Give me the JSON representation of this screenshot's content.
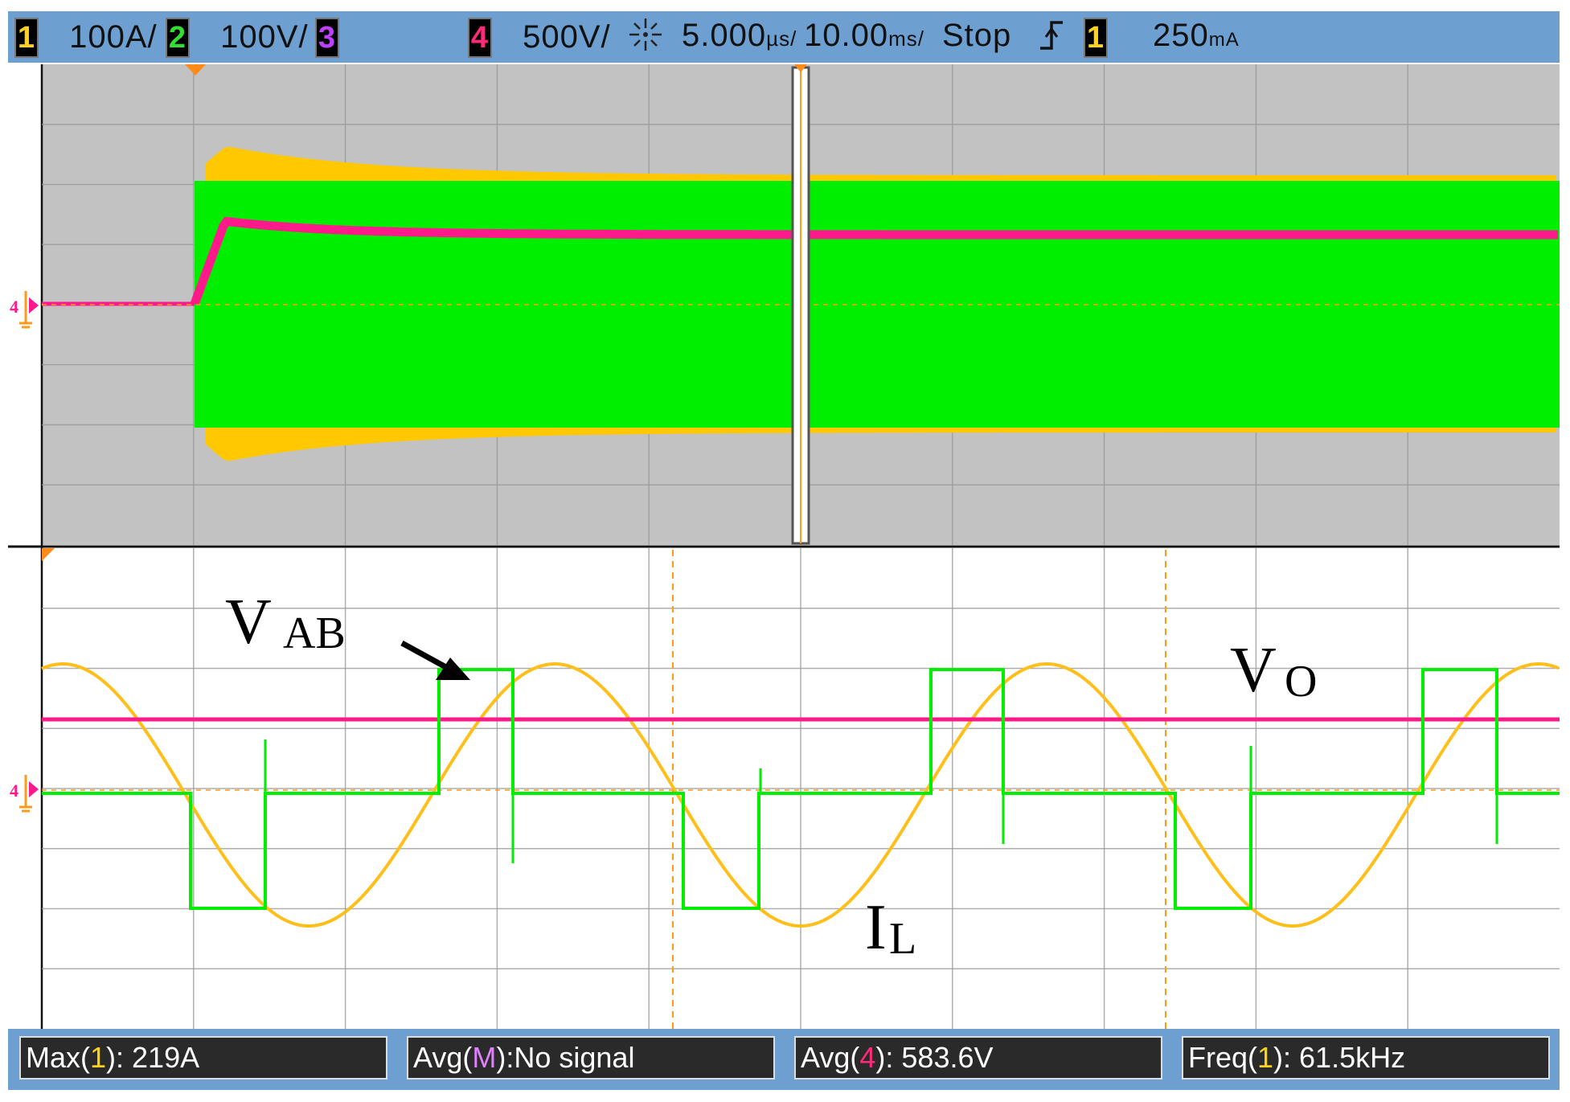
{
  "header": {
    "channels": [
      {
        "num": "1",
        "scale": "100A/",
        "color": "#ffd21a"
      },
      {
        "num": "2",
        "scale": "100V/",
        "color": "#33dd33"
      },
      {
        "num": "3",
        "scale": "",
        "color": "#c040ff"
      },
      {
        "num": "4",
        "scale": "500V/",
        "color": "#ff2a7a"
      }
    ],
    "timebase_zoom": "5.000",
    "timebase_zoom_unit": "µs/",
    "timebase_main": "10.00",
    "timebase_main_unit": "ms/",
    "run_state": "Stop",
    "trigger_channel": "1",
    "trigger_level": "250",
    "trigger_level_unit": "mA",
    "acq_icon": "sparkle-icon",
    "trigger_icon": "rising-edge-icon"
  },
  "colors": {
    "ch1": "#ffc800",
    "ch2": "#00ee00",
    "ch4": "#ff1a8c",
    "grid": "#9a9a9a",
    "marker": "#ff9a1a"
  },
  "annotations": {
    "vab_main": "V",
    "vab_sub": "AB",
    "vo_main": "V",
    "vo_sub": "O",
    "il_main": "I",
    "il_sub": "L"
  },
  "ground_marker": "4",
  "measurements": [
    {
      "label": "Max(",
      "ch": "1",
      "ch_color": "#ffd21a",
      "rest": "): 219A"
    },
    {
      "label": "Avg(",
      "ch": "M",
      "ch_color": "#e080ff",
      "rest": "):No signal"
    },
    {
      "label": "Avg(",
      "ch": "4",
      "ch_color": "#ff2a7a",
      "rest": "): 583.6V"
    },
    {
      "label": "Freq(",
      "ch": "1",
      "ch_color": "#ffd21a",
      "rest": "): 61.5kHz"
    }
  ],
  "chart_data": [
    {
      "type": "line",
      "title": "",
      "series": [
        {
          "name": "",
          "channel": "1",
          "envelope": "AC band, overshoot after start then settles"
        },
        {
          "name": "",
          "channel": "2",
          "envelope": "square band starting at start time"
        },
        {
          "name": "",
          "channel": "4",
          "envelope": "steps up at start, overshoot then settles"
        }
      ],
      "x_divisions": 10,
      "y_divisions": 8,
      "grid": true
    },
    {
      "type": "line",
      "title": "",
      "x_divisions": 10,
      "y_divisions": 8,
      "grid": true,
      "series": [
        {
          "name": "",
          "channel": "1",
          "shape": "sine",
          "cycles": 3.1
        },
        {
          "name": "",
          "channel": "2",
          "shape": "quasi-square with dead time",
          "cycles": 3.1
        },
        {
          "name": "",
          "channel": "4",
          "shape": "dc"
        }
      ]
    }
  ]
}
